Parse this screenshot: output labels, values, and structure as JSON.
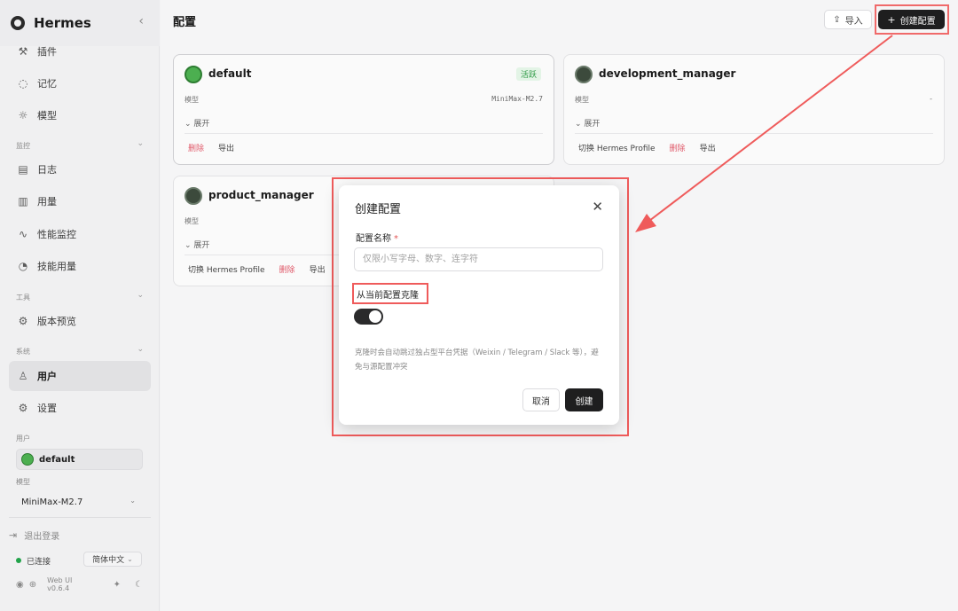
{
  "app": {
    "title": "Hermes",
    "collapse_icon": "chevron-left-icon"
  },
  "sidebar": {
    "top_items": [
      {
        "label": "插件",
        "icon": "wrench-icon"
      },
      {
        "label": "记忆",
        "icon": "bulb-icon"
      },
      {
        "label": "模型",
        "icon": "sun-icon"
      }
    ],
    "monitor_section": "监控",
    "monitor_items": [
      {
        "label": "日志",
        "icon": "file-icon"
      },
      {
        "label": "用量",
        "icon": "bar-chart-icon"
      },
      {
        "label": "性能监控",
        "icon": "pulse-icon"
      },
      {
        "label": "技能用量",
        "icon": "pie-icon"
      }
    ],
    "tools_section": "工具",
    "tools_items": [
      {
        "label": "版本预览",
        "icon": "gear-icon"
      }
    ],
    "system_section": "系统",
    "system_items": [
      {
        "label": "用户",
        "icon": "user-icon",
        "active": true
      },
      {
        "label": "设置",
        "icon": "settings-icon"
      }
    ],
    "user_label": "用户",
    "user_name": "default",
    "model_label": "模型",
    "model_value": "MiniMax-M2.7",
    "logout": "退出登录",
    "status": "已连接",
    "language": "简体中文",
    "version": "Web UI v0.6.4"
  },
  "main": {
    "title": "配置",
    "import_label": "导入",
    "create_label": "创建配置",
    "cards": [
      {
        "name": "default",
        "badge": "活跃",
        "model_label": "模型",
        "model_value": "MiniMax-M2.7",
        "expand": "展开",
        "actions": [
          "删除",
          "导出"
        ]
      },
      {
        "name": "development_manager",
        "model_label": "模型",
        "model_value": "-",
        "expand": "展开",
        "actions": [
          "切换 Hermes Profile",
          "删除",
          "导出"
        ]
      },
      {
        "name": "product_manager",
        "model_label": "模型",
        "expand": "展开",
        "actions": [
          "切换 Hermes Profile",
          "删除",
          "导出"
        ]
      }
    ]
  },
  "modal": {
    "title": "创建配置",
    "name_label": "配置名称",
    "required_mark": "*",
    "name_placeholder": "仅限小写字母、数字、连字符",
    "clone_label": "从当前配置克隆",
    "clone_enabled": true,
    "hint": "克隆时会自动跳过独占型平台凭据（Weixin / Telegram / Slack 等），避免与源配置冲突",
    "cancel": "取消",
    "confirm": "创建"
  },
  "colors": {
    "accent_dark": "#1e1e1f",
    "annotation_red": "#ef5b5b",
    "active_green": "#2e9a45",
    "danger": "#e05a6a"
  }
}
